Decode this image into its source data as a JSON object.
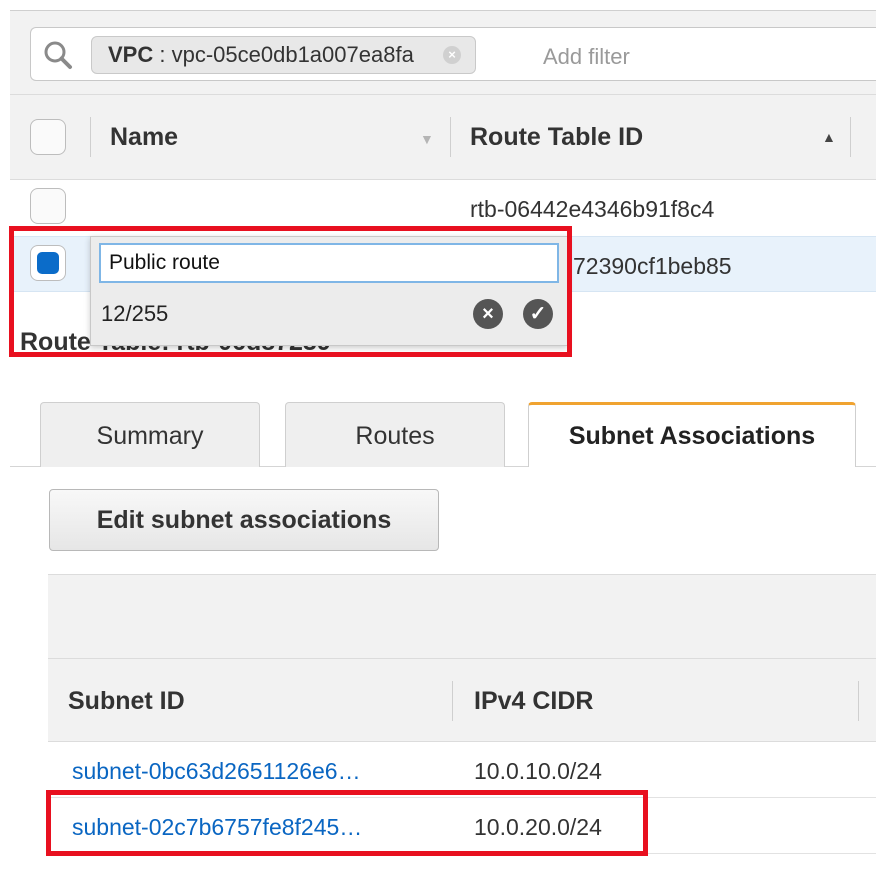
{
  "filter": {
    "token_key": "VPC",
    "token_sep": " : ",
    "token_value": "vpc-05ce0db1a007ea8fa",
    "placeholder": "Add filter"
  },
  "table": {
    "columns": [
      "Name",
      "Route Table ID"
    ],
    "rows": [
      {
        "route_table_id": "rtb-06442e4346b91f8c4"
      },
      {
        "route_table_id_visible": "72390cf1beb85"
      }
    ]
  },
  "edit_popup": {
    "value": "Public route",
    "char_count": "12/255"
  },
  "detail": {
    "title_partial": "Route Table: rtb-06d87239"
  },
  "tabs": [
    "Summary",
    "Routes",
    "Subnet Associations"
  ],
  "active_tab": "Subnet Associations",
  "subnet_panel": {
    "edit_button": "Edit subnet associations",
    "columns": [
      "Subnet ID",
      "IPv4 CIDR"
    ],
    "rows": [
      {
        "subnet_id": "subnet-0bc63d2651126e6…",
        "cidr": "10.0.10.0/24"
      },
      {
        "subnet_id": "subnet-02c7b6757fe8f245…",
        "cidr": "10.0.20.0/24"
      }
    ]
  },
  "colors": {
    "highlight": "#e8101f",
    "selected_row": "#e8f2fb",
    "link": "#0a66c2",
    "active_tab_accent": "#f0a330"
  }
}
